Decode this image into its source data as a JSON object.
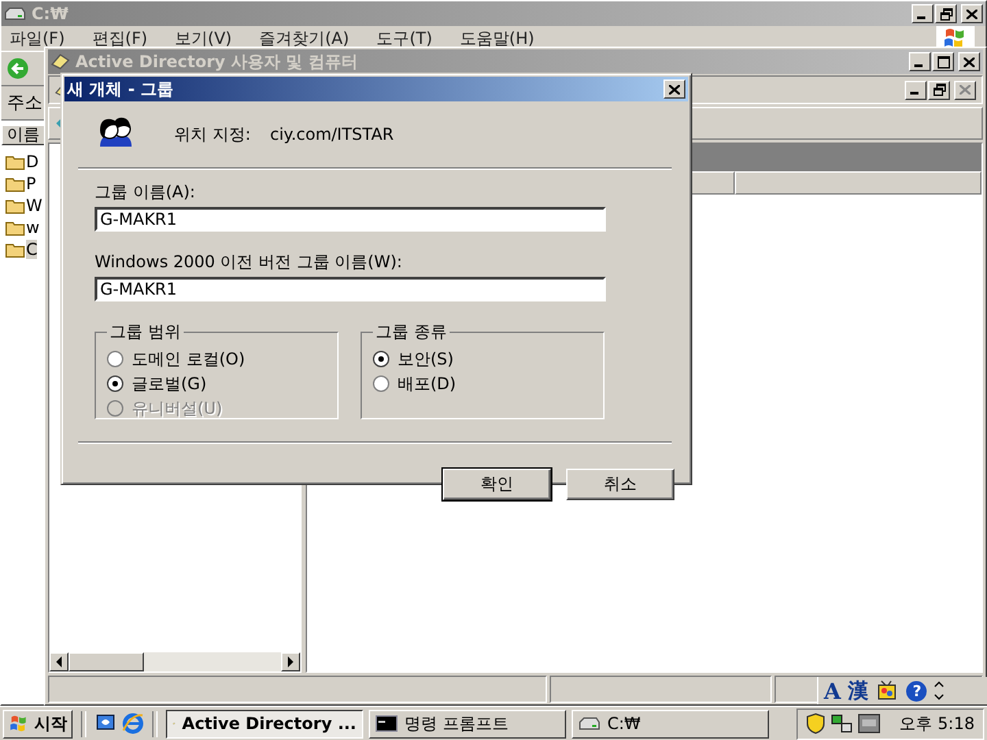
{
  "explorer": {
    "title": "C:₩",
    "menu": [
      "파일(F)",
      "편집(F)",
      "보기(V)",
      "즐겨찾기(A)",
      "도구(T)",
      "도움말(H)"
    ],
    "address_label": "주소",
    "list_header": "이름",
    "items": [
      {
        "label": "D",
        "selected": false
      },
      {
        "label": "P",
        "selected": false
      },
      {
        "label": "W",
        "selected": false
      },
      {
        "label": "w",
        "selected": false
      },
      {
        "label": "C",
        "selected": true
      }
    ]
  },
  "ad_window": {
    "title": "Active Directory 사용자 및 컴퓨터"
  },
  "dialog": {
    "title": "새 개체 - 그룹",
    "location_label": "위치 지정:",
    "location": "ciy.com/ITSTAR",
    "fields": [
      {
        "label": "그룹 이름(A):",
        "value": "G-MAKR1"
      },
      {
        "label": "Windows 2000 이전 버전 그룹 이름(W):",
        "value": "G-MAKR1"
      }
    ],
    "groups": [
      {
        "title": "그룹 범위",
        "options": [
          {
            "label": "도메인 로컬(O)",
            "selected": false,
            "disabled": false
          },
          {
            "label": "글로벌(G)",
            "selected": true,
            "disabled": false
          },
          {
            "label": "유니버설(U)",
            "selected": false,
            "disabled": true
          }
        ]
      },
      {
        "title": "그룹 종류",
        "options": [
          {
            "label": "보안(S)",
            "selected": true,
            "disabled": false
          },
          {
            "label": "배포(D)",
            "selected": false,
            "disabled": false
          }
        ]
      }
    ],
    "buttons": [
      {
        "label": "확인",
        "default": true
      },
      {
        "label": "취소",
        "default": false
      }
    ]
  },
  "language_bar": {
    "items": [
      "A",
      "漢"
    ],
    "help": "?"
  },
  "taskbar": {
    "start": "시작",
    "tasks": [
      {
        "label": "Active Directory ...",
        "selected": true,
        "kind": "mmc"
      },
      {
        "label": "명령 프롬프트",
        "selected": false,
        "kind": "console"
      },
      {
        "label": "C:₩",
        "selected": false,
        "kind": "drive"
      }
    ],
    "clock": "오후 5:18"
  }
}
